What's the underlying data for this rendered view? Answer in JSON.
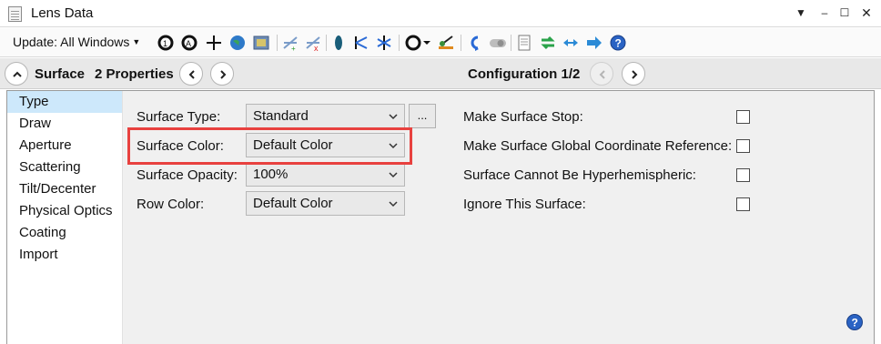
{
  "window": {
    "title": "Lens Data"
  },
  "toolbar": {
    "update_label": "Update: All Windows",
    "icons": [
      "refresh-icon",
      "refresh-all-icon",
      "crosshair-icon",
      "globe-icon",
      "image-icon",
      "add-ray-icon",
      "delete-ray-icon",
      "lens-icon",
      "ray-trace-icon",
      "ray-fan-icon",
      "circle-ring-icon",
      "paint-icon",
      "undo-icon",
      "toggle-icon",
      "document-icon",
      "swap-icon",
      "resize-icon",
      "next-arrow-icon",
      "help-icon"
    ]
  },
  "nav": {
    "surface_label": "Surface",
    "properties_label": "2 Properties",
    "configuration_label": "Configuration 1/2"
  },
  "sidebar": {
    "items": [
      {
        "label": "Type",
        "selected": true
      },
      {
        "label": "Draw"
      },
      {
        "label": "Aperture"
      },
      {
        "label": "Scattering"
      },
      {
        "label": "Tilt/Decenter"
      },
      {
        "label": "Physical Optics"
      },
      {
        "label": "Coating"
      },
      {
        "label": "Import"
      }
    ]
  },
  "form": {
    "surface_type": {
      "label": "Surface Type:",
      "value": "Standard"
    },
    "more_button_label": "...",
    "surface_color": {
      "label": "Surface Color:",
      "value": "Default Color"
    },
    "surface_opacity": {
      "label": "Surface Opacity:",
      "value": "100%"
    },
    "row_color": {
      "label": "Row Color:",
      "value": "Default Color"
    },
    "make_surface_stop": {
      "label": "Make Surface Stop:",
      "checked": false
    },
    "global_coord_ref": {
      "label": "Make Surface Global Coordinate Reference:",
      "checked": false
    },
    "cannot_be_hyperhemispheric": {
      "label": "Surface Cannot Be Hyperhemispheric:",
      "checked": false
    },
    "ignore_surface": {
      "label": "Ignore This Surface:",
      "checked": false
    }
  },
  "colors": {
    "highlight": "#e8413f",
    "selected_bg": "#cde8fb",
    "help_blue": "#2a63c4"
  }
}
